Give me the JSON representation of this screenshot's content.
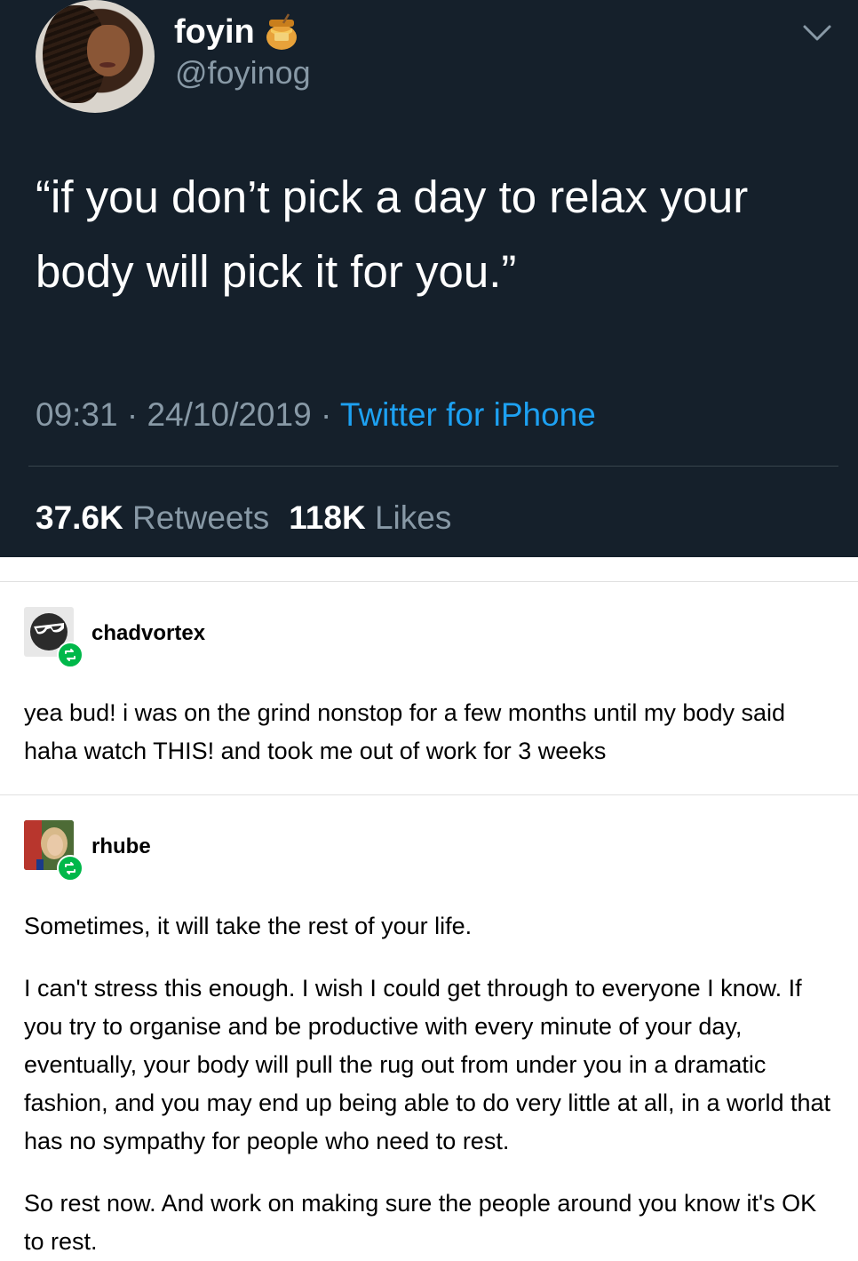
{
  "tweet": {
    "display_name": "foyin",
    "name_emoji_icon": "honey-pot-icon",
    "handle": "@foyinog",
    "text": "“if you don’t pick a day to relax your body will pick it for you.”",
    "time": "09:31",
    "separator": "·",
    "date": "24/10/2019",
    "source": "Twitter for iPhone",
    "retweets_count": "37.6K",
    "retweets_label": "Retweets",
    "likes_count": "118K",
    "likes_label": "Likes",
    "colors": {
      "background": "#15202b",
      "secondary_text": "#8899a6",
      "link": "#1da1f2"
    }
  },
  "reblogs": [
    {
      "username": "chadvortex",
      "avatar_icon": "sunglasses-face-icon",
      "badge_icon": "reblog-icon",
      "text": "yea bud! i was on the grind nonstop for a few months until my body said haha watch THIS! and took me out of work for 3 weeks"
    },
    {
      "username": "rhube",
      "avatar_icon": "user-photo",
      "badge_icon": "reblog-icon",
      "paragraphs": [
        "Sometimes, it will take the rest of your life.",
        "I can't stress this enough. I wish I could get through to everyone I know. If you try to organise and be productive with every minute of your day, eventually, your body will pull the rug out from under you in a dramatic fashion, and you may end up being able to do very little at all, in a world that has no sympathy for people who need to rest.",
        "So rest now. And work on making sure the people around you know it's OK to rest."
      ]
    }
  ],
  "colors": {
    "reblog_badge": "#00b84a"
  }
}
